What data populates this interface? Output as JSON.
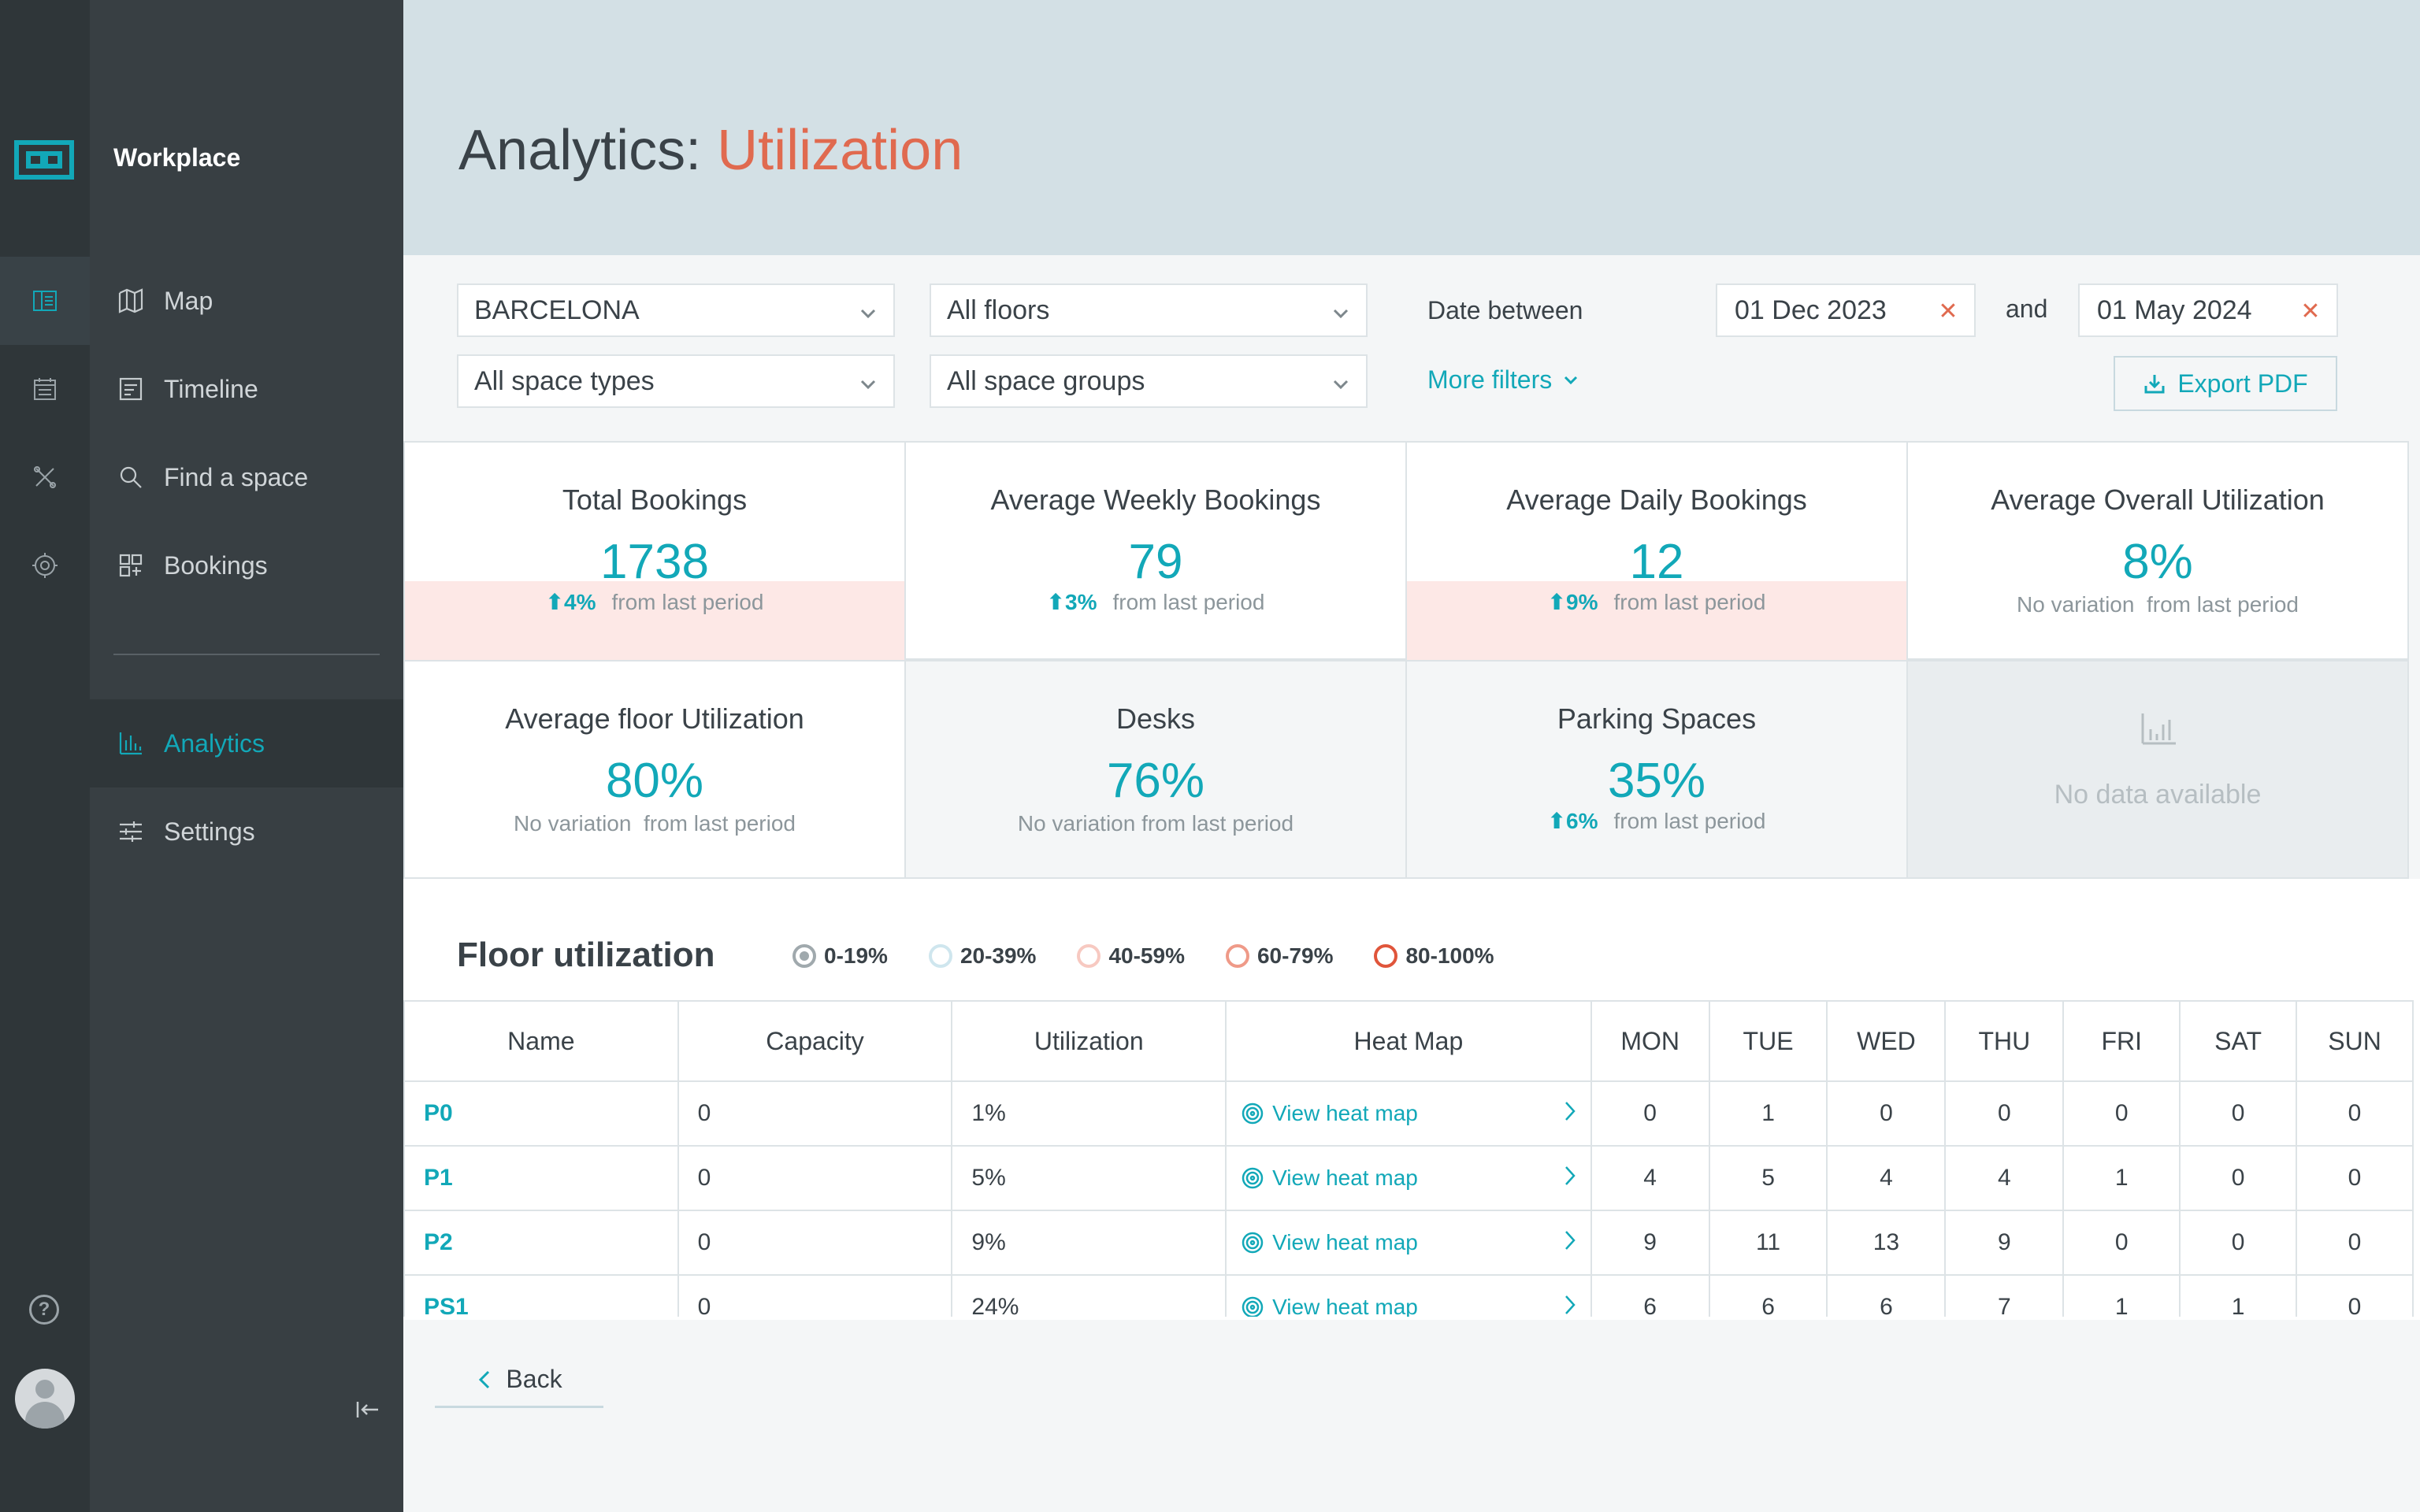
{
  "app": {
    "name": "Workplace"
  },
  "nav": {
    "items": [
      {
        "label": "Map",
        "icon": "map-icon"
      },
      {
        "label": "Timeline",
        "icon": "timeline-icon"
      },
      {
        "label": "Find a space",
        "icon": "search-icon"
      },
      {
        "label": "Bookings",
        "icon": "bookings-icon"
      },
      {
        "label": "Analytics",
        "icon": "bar-chart-icon",
        "active": true
      },
      {
        "label": "Settings",
        "icon": "sliders-icon"
      }
    ]
  },
  "header": {
    "title_prefix": "Analytics:",
    "title_accent": "Utilization"
  },
  "filters": {
    "location": "BARCELONA",
    "floors": "All floors",
    "space_types": "All space types",
    "space_groups": "All space groups",
    "date_label": "Date between",
    "date_from": "01 Dec 2023",
    "and_label": "and",
    "date_to": "01 May 2024",
    "more_filters": "More filters",
    "export": "Export PDF"
  },
  "stats": [
    {
      "title": "Total Bookings",
      "value": "1738",
      "change": "4%",
      "note": "from last period",
      "highlight": true
    },
    {
      "title": "Average Weekly Bookings",
      "value": "79",
      "change": "3%",
      "note": "from last period",
      "highlight": false
    },
    {
      "title": "Average Daily Bookings",
      "value": "12",
      "change": "9%",
      "note": "from last period",
      "highlight": true
    },
    {
      "title": "Average Overall Utilization",
      "value": "8%",
      "change": "No variation",
      "note": "from last period",
      "highlight": false
    },
    {
      "title": "Average floor Utilization",
      "value": "80%",
      "change": "No variation",
      "note": "from last period",
      "highlight": false
    },
    {
      "title": "Desks",
      "value": "76%",
      "change": "No variation",
      "note": "from last period",
      "highlight": false
    },
    {
      "title": "Parking Spaces",
      "value": "35%",
      "change": "6%",
      "note": "from last period",
      "highlight": false
    },
    {
      "title": "",
      "value": "",
      "change": "",
      "note": "No data available",
      "nodata": true
    }
  ],
  "floor_utilization": {
    "title": "Floor utilization",
    "legend": [
      "0-19%",
      "20-39%",
      "40-59%",
      "60-79%",
      "80-100%"
    ],
    "columns": [
      "Name",
      "Capacity",
      "Utilization",
      "Heat Map",
      "MON",
      "TUE",
      "WED",
      "THU",
      "FRI",
      "SAT",
      "SUN"
    ],
    "heatmap_link": "View heat map",
    "rows": [
      {
        "name": "P0",
        "capacity": "0",
        "utilization": "1%",
        "days": [
          "0",
          "1",
          "0",
          "0",
          "0",
          "0",
          "0"
        ]
      },
      {
        "name": "P1",
        "capacity": "0",
        "utilization": "5%",
        "days": [
          "4",
          "5",
          "4",
          "4",
          "1",
          "0",
          "0"
        ]
      },
      {
        "name": "P2",
        "capacity": "0",
        "utilization": "9%",
        "days": [
          "9",
          "11",
          "13",
          "9",
          "0",
          "0",
          "0"
        ]
      },
      {
        "name": "PS1",
        "capacity": "0",
        "utilization": "24%",
        "days": [
          "6",
          "6",
          "6",
          "7",
          "1",
          "1",
          "0"
        ]
      }
    ]
  },
  "footer": {
    "back": "Back"
  }
}
